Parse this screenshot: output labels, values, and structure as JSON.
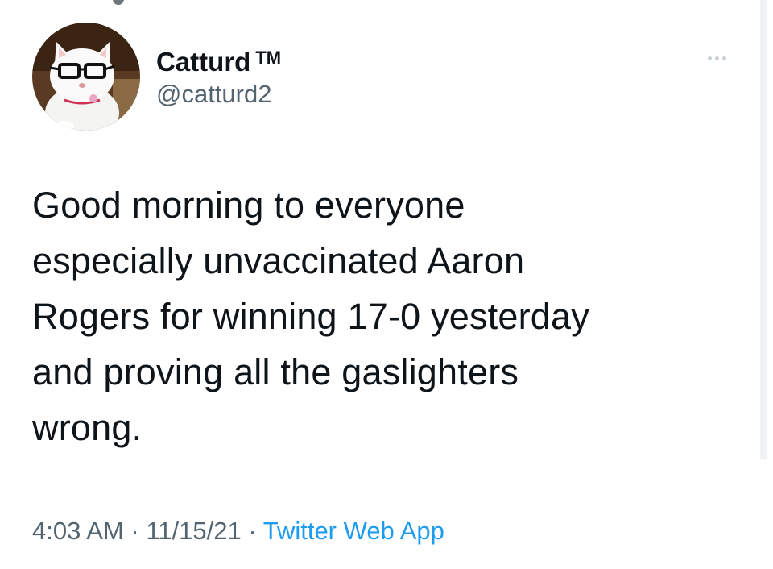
{
  "tweet": {
    "author": {
      "display_name": "Catturd",
      "trademark": "TM",
      "handle": "@catturd2",
      "avatar_icon": "cat-with-glasses-avatar"
    },
    "text": "Good morning to everyone\nespecially unvaccinated Aaron\nRogers for winning 17-0 yesterday\nand proving all the gaslighters\nwrong.",
    "time": "4:03 AM",
    "date": "11/15/21",
    "separator": "·",
    "source": "Twitter Web App"
  },
  "colors": {
    "primary_text": "#0f1419",
    "secondary_text": "#536471",
    "link": "#1d9bf0"
  },
  "icons": {
    "more": "more-options-icon"
  }
}
